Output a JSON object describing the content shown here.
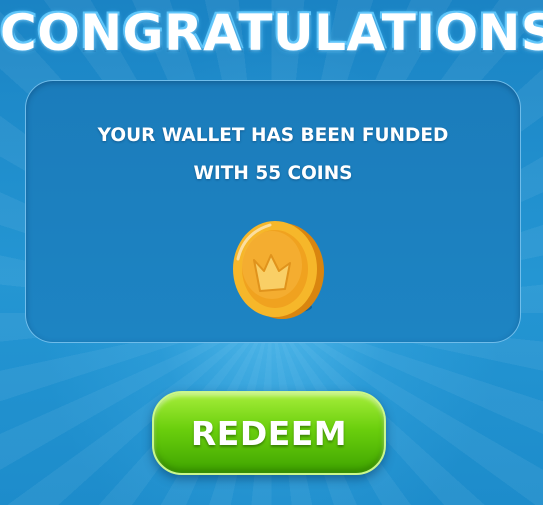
{
  "title": "CONGRATULATIONS",
  "message": {
    "line1": "YOUR WALLET HAS BEEN FUNDED",
    "line2": "WITH 55 COINS"
  },
  "coin": {
    "icon": "crown-coin-icon",
    "colors": {
      "gold": "#f6b72a",
      "gold_dark": "#e08a12",
      "crown": "#f9cf66"
    }
  },
  "redeem_button": {
    "label": "REDEEM",
    "color": "#6bcf0d"
  },
  "colors": {
    "background": "#1f8fcc",
    "panel": "#1b7cbb"
  }
}
